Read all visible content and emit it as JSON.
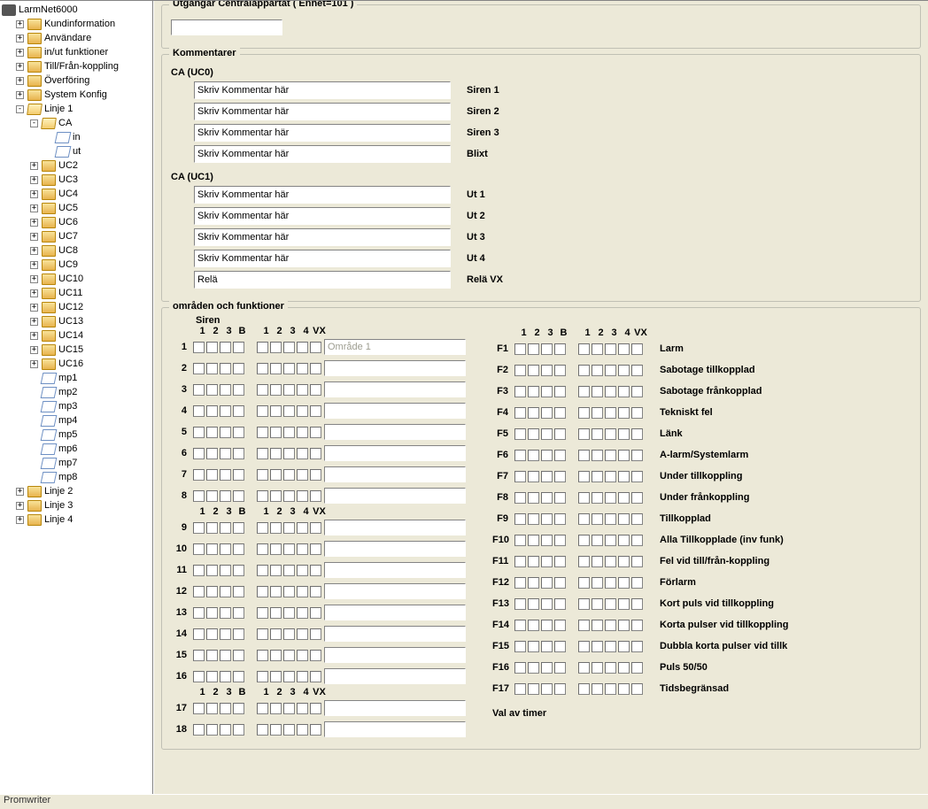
{
  "status_bar": "Promwriter",
  "tree": {
    "root": "LarmNet6000",
    "top_items": [
      "Kundinformation",
      "Användare",
      "in/ut funktioner",
      "Till/Från-koppling",
      "Överföring",
      "System Konfig"
    ],
    "linje1": "Linje 1",
    "ca_node": "CA",
    "ca_children": [
      "in",
      "ut"
    ],
    "uc_nodes": [
      "UC2",
      "UC3",
      "UC4",
      "UC5",
      "UC6",
      "UC7",
      "UC8",
      "UC9",
      "UC10",
      "UC11",
      "UC12",
      "UC13",
      "UC14",
      "UC15",
      "UC16"
    ],
    "mp_nodes": [
      "mp1",
      "mp2",
      "mp3",
      "mp4",
      "mp5",
      "mp6",
      "mp7",
      "mp8"
    ],
    "bottom_linjer": [
      "Linje 2",
      "Linje 3",
      "Linje 4"
    ]
  },
  "groups": {
    "outputs_title": "Utgångar Centralappartat ( Enhet=101 )",
    "comments_title": "Kommentarer",
    "areas_title": "områden och funktioner"
  },
  "comments": {
    "uc0_header": "CA (UC0)",
    "uc1_header": "CA (UC1)",
    "placeholder": "Skriv Kommentar här",
    "rela_val": "Relä",
    "uc0_labels": [
      "Siren 1",
      "Siren 2",
      "Siren 3",
      "Blixt"
    ],
    "uc1_labels": [
      "Ut 1",
      "Ut 2",
      "Ut 3",
      "Ut 4",
      "Relä VX"
    ]
  },
  "areas": {
    "siren_title": "Siren",
    "headers_left": [
      "1",
      "2",
      "3",
      "B"
    ],
    "headers_right": [
      "1",
      "2",
      "3",
      "4",
      "VX"
    ],
    "area1_placeholder": "Område 1",
    "func_labels": [
      "Larm",
      "Sabotage tillkopplad",
      "Sabotage frånkopplad",
      "Tekniskt fel",
      "Länk",
      "A-larm/Systemlarm",
      "Under tillkoppling",
      "Under frånkoppling",
      "Tillkopplad",
      "Alla Tillkopplade  (inv funk)",
      "Fel vid till/från-koppling",
      "Förlarm",
      "Kort puls vid tillkoppling",
      "Korta pulser vid tillkoppling",
      "Dubbla korta pulser vid tillk",
      "Puls 50/50",
      "Tidsbegränsad"
    ],
    "timer_title": "Val av timer"
  },
  "f_prefix": "F"
}
